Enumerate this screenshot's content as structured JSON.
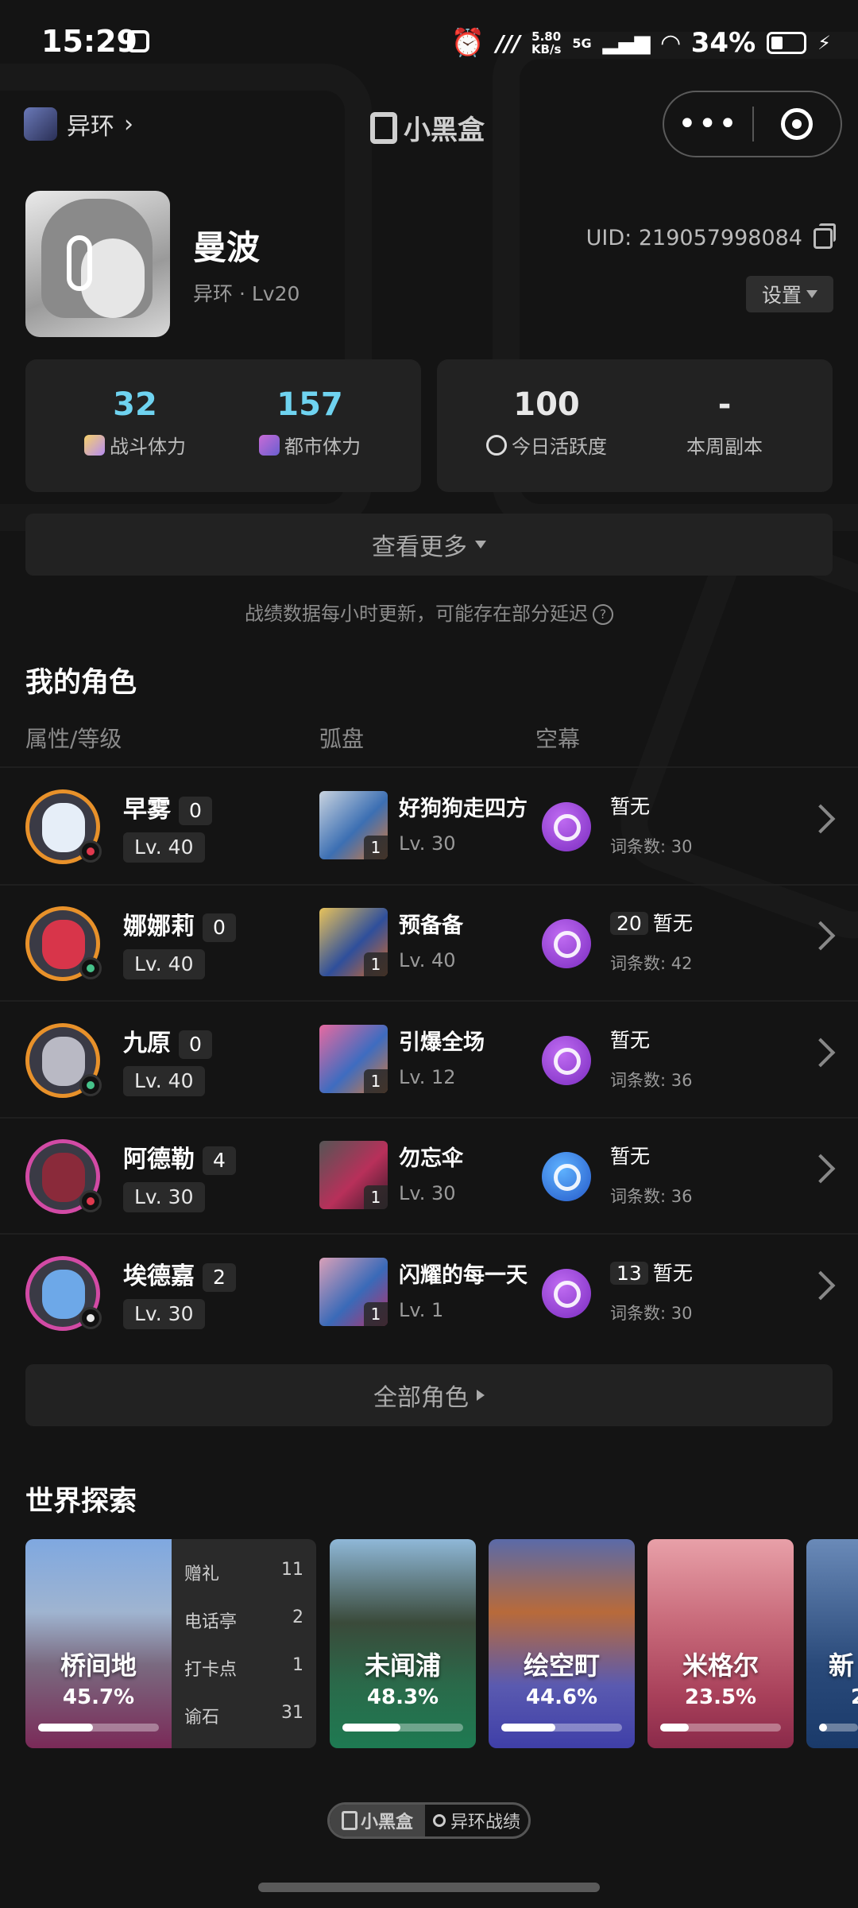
{
  "status_bar": {
    "time": "15:29",
    "net_speed": "5.80",
    "net_unit": "KB/s",
    "network": "5G",
    "battery": "34%"
  },
  "header": {
    "game_name": "异环",
    "brand_name": "小黑盒",
    "menu_label": "•••"
  },
  "profile": {
    "name": "曼波",
    "game": "异环",
    "level": "Lv20",
    "uid": "UID: 219057998084",
    "settings_label": "设置"
  },
  "stats": [
    {
      "value": "32",
      "label": "战斗体力",
      "color": "#6fd3f0"
    },
    {
      "value": "157",
      "label": "都市体力",
      "color": "#6fd3f0"
    },
    {
      "value": "100",
      "label": "今日活跃度",
      "color": "#ffffff"
    },
    {
      "value": "-",
      "label": "本周副本",
      "color": "#ffffff"
    }
  ],
  "more_label": "查看更多",
  "update_note": "战绩数据每小时更新，可能存在部分延迟",
  "roles": {
    "title": "我的角色",
    "columns": [
      "属性/等级",
      "弧盘",
      "空幕"
    ],
    "items": [
      {
        "name": "早雾",
        "count": "0",
        "level": "Lv. 40",
        "disc": "好狗狗走四方",
        "disc_level": "Lv. 30",
        "disc_badge": "1",
        "sky_num": "",
        "sky": "暂无",
        "entries": "词条数: 30"
      },
      {
        "name": "娜娜莉",
        "count": "0",
        "level": "Lv. 40",
        "disc": "预备备",
        "disc_level": "Lv. 40",
        "disc_badge": "1",
        "sky_num": "20",
        "sky": "暂无",
        "entries": "词条数: 42"
      },
      {
        "name": "九原",
        "count": "0",
        "level": "Lv. 40",
        "disc": "引爆全场",
        "disc_level": "Lv. 12",
        "disc_badge": "1",
        "sky_num": "",
        "sky": "暂无",
        "entries": "词条数: 36"
      },
      {
        "name": "阿德勒",
        "count": "4",
        "level": "Lv. 30",
        "disc": "勿忘伞",
        "disc_level": "Lv. 30",
        "disc_badge": "1",
        "sky_num": "",
        "sky": "暂无",
        "entries": "词条数: 36"
      },
      {
        "name": "埃德嘉",
        "count": "2",
        "level": "Lv. 30",
        "disc": "闪耀的每一天",
        "disc_level": "Lv. 1",
        "disc_badge": "1",
        "sky_num": "13",
        "sky": "暂无",
        "entries": "词条数: 30"
      }
    ],
    "all_label": "全部角色"
  },
  "world": {
    "title": "世界探索",
    "regions": [
      {
        "name": "桥间地",
        "percent": "45.7%",
        "progress": 0.457
      },
      {
        "name": "未闻浦",
        "percent": "48.3%",
        "progress": 0.483
      },
      {
        "name": "绘空町",
        "percent": "44.6%",
        "progress": 0.446
      },
      {
        "name": "米格尔",
        "percent": "23.5%",
        "progress": 0.235
      },
      {
        "name": "新",
        "percent": "2",
        "progress": 0.2
      }
    ],
    "first_stats": [
      {
        "label": "赠礼",
        "value": "11"
      },
      {
        "label": "电话亭",
        "value": "2"
      },
      {
        "label": "打卡点",
        "value": "1"
      },
      {
        "label": "谕石",
        "value": "31"
      }
    ]
  },
  "footer": {
    "brand": "小黑盒",
    "search_label": "异环战绩"
  }
}
